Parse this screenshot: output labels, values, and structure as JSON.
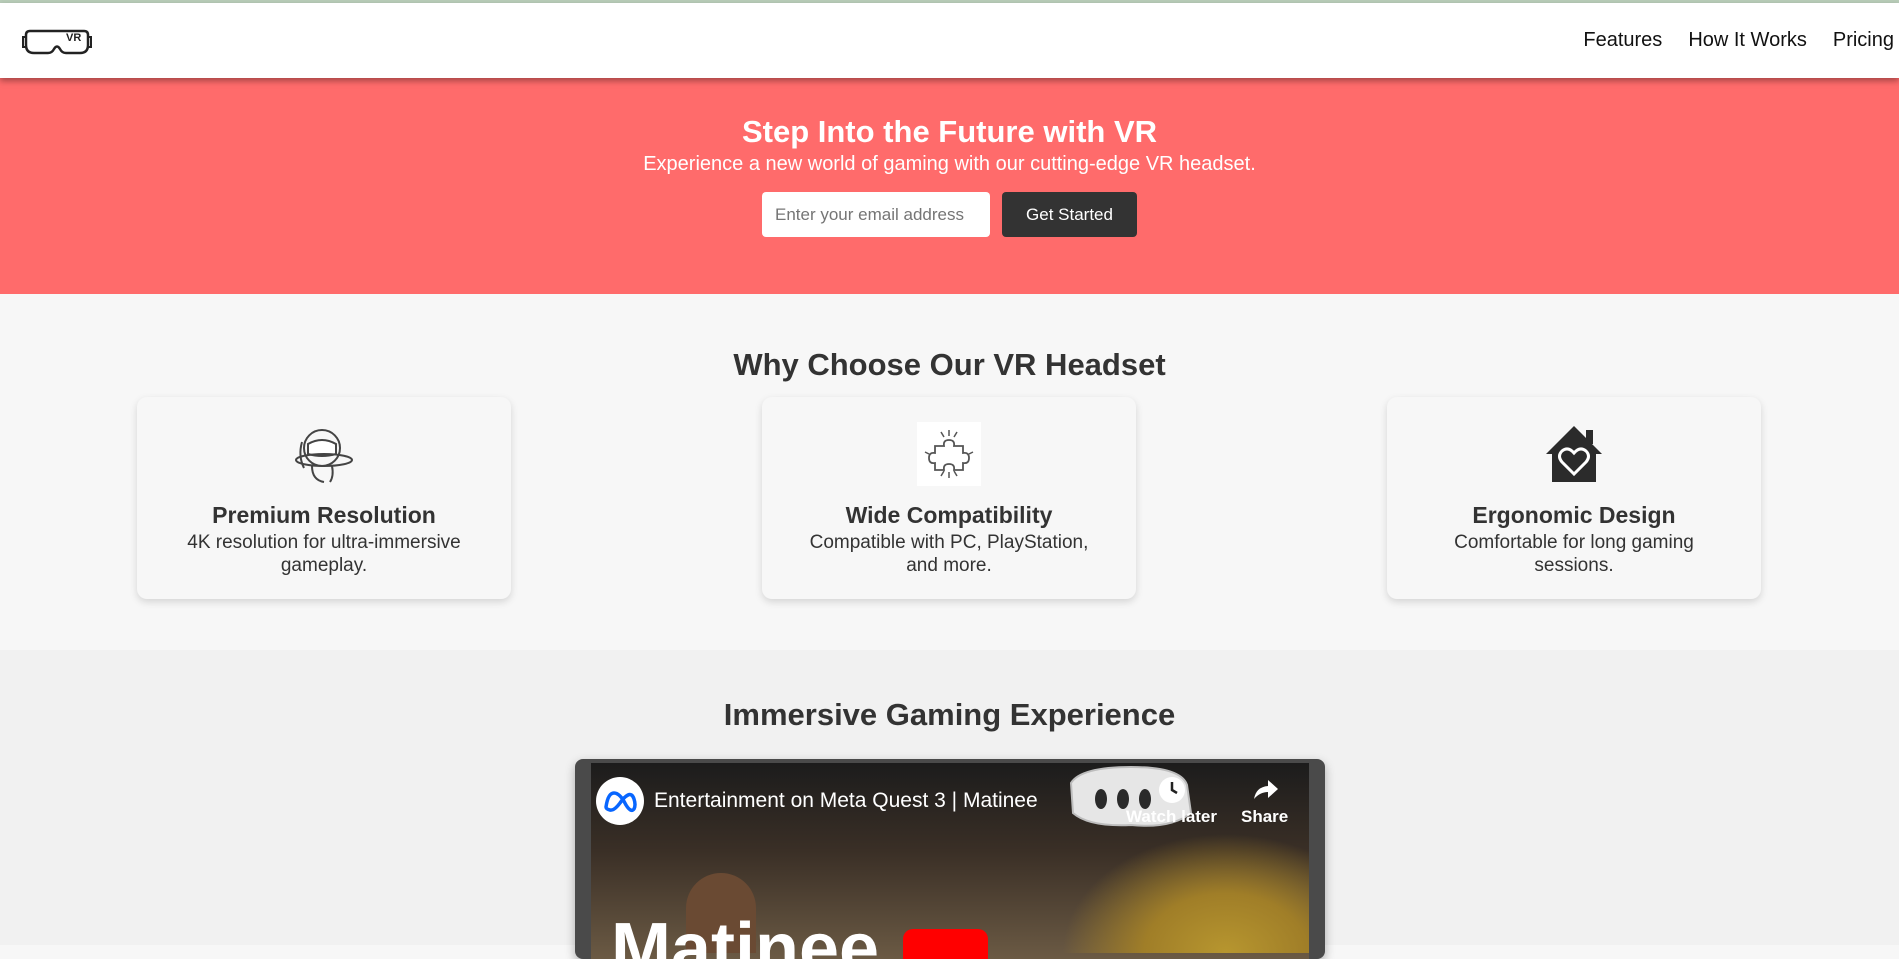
{
  "header": {
    "logo_text": "VR",
    "nav": [
      "Features",
      "How It Works",
      "Pricing"
    ]
  },
  "hero": {
    "title": "Step Into the Future with VR",
    "subtitle": "Experience a new world of gaming with our cutting-edge VR headset.",
    "email_placeholder": "Enter your email address",
    "cta_label": "Get Started",
    "background_color": "#ff6b6b"
  },
  "features": {
    "title": "Why Choose Our VR Headset",
    "cards": [
      {
        "icon": "vr-user-icon",
        "title": "Premium Resolution",
        "description": "4K resolution for ultra-immersive gameplay."
      },
      {
        "icon": "puzzle-icon",
        "title": "Wide Compatibility",
        "description": "Compatible with PC, PlayStation, and more."
      },
      {
        "icon": "house-heart-icon",
        "title": "Ergonomic Design",
        "description": "Comfortable for long gaming sessions."
      }
    ]
  },
  "video": {
    "section_title": "Immersive Gaming Experience",
    "title": "Entertainment on Meta Quest 3 | Matinee",
    "watch_later_label": "Watch later",
    "share_label": "Share",
    "overlay_title": "Matinee"
  }
}
